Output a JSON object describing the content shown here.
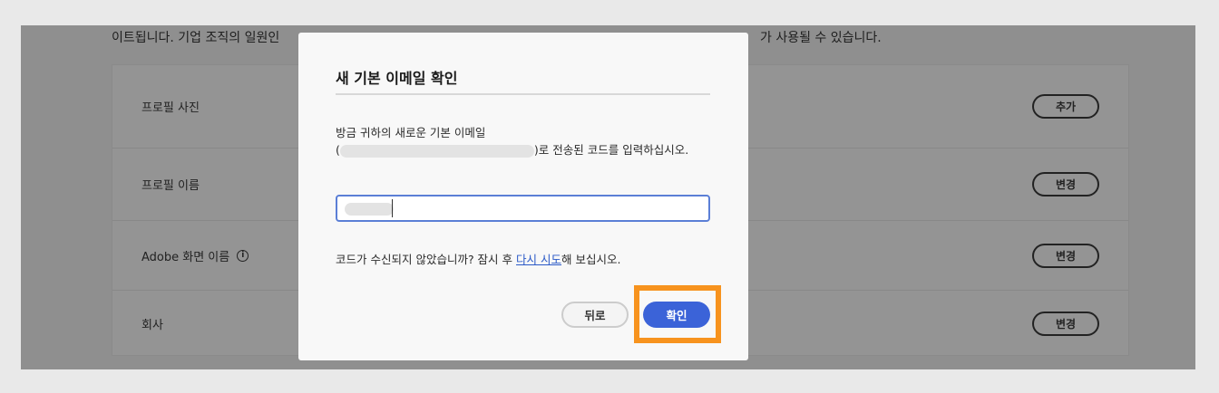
{
  "background": {
    "intro_left": "이트됩니다. 기업 조직의 일원인",
    "intro_right": "가 사용될 수 있습니다.",
    "rows": [
      {
        "label": "프로필 사진",
        "button": "추가"
      },
      {
        "label": "프로필 이름",
        "button": "변경"
      },
      {
        "label": "Adobe 화면 이름",
        "button": "변경",
        "info": "i"
      },
      {
        "label": "회사",
        "button": "변경"
      }
    ]
  },
  "modal": {
    "title": "새 기본 이메일 확인",
    "desc_line1": "방금 귀하의 새로운 기본 이메일",
    "desc_open": "(",
    "desc_rest": ")로 전송된 코드를 입력하십시오.",
    "resend_prefix": "코드가 수신되지 않았습니까? 잠시 후 ",
    "resend_link": "다시 시도",
    "resend_suffix": "해 보십시오.",
    "back_label": "뒤로",
    "confirm_label": "확인"
  },
  "colors": {
    "accent": "#3b63d8",
    "highlight": "#f7931e",
    "link": "#2a59c7"
  }
}
